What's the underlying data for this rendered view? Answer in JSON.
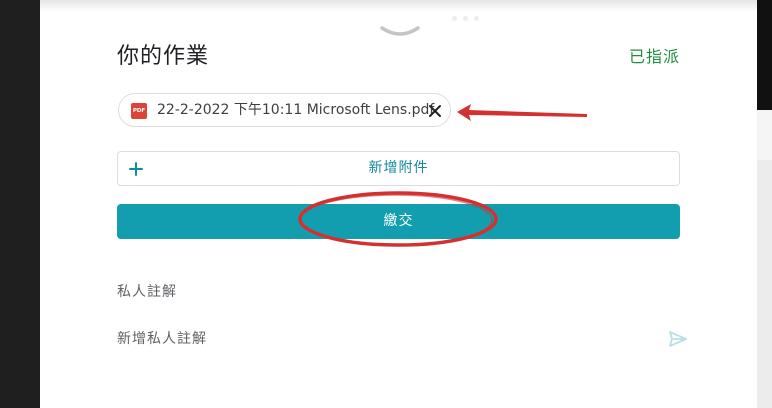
{
  "work": {
    "title": "你的作業",
    "status": "已指派",
    "attachment": {
      "icon_text": "PDF",
      "file_name": "22-2-2022 下午10:11 Microsoft Lens.pdf"
    },
    "add_attachment_label": "新增附件",
    "submit_label": "繳交"
  },
  "private_comments": {
    "heading": "私人註解",
    "placeholder": "新增私人註解"
  },
  "colors": {
    "status_green": "#1e8e3e",
    "teal": "#129eaf",
    "pdf_red": "#db4437",
    "annotation_red": "#d33131"
  },
  "icons": {
    "chevron": "chevron-down-icon",
    "pdf": "pdf-file-icon",
    "close": "close-icon",
    "add": "plus-icon",
    "send": "send-icon"
  }
}
